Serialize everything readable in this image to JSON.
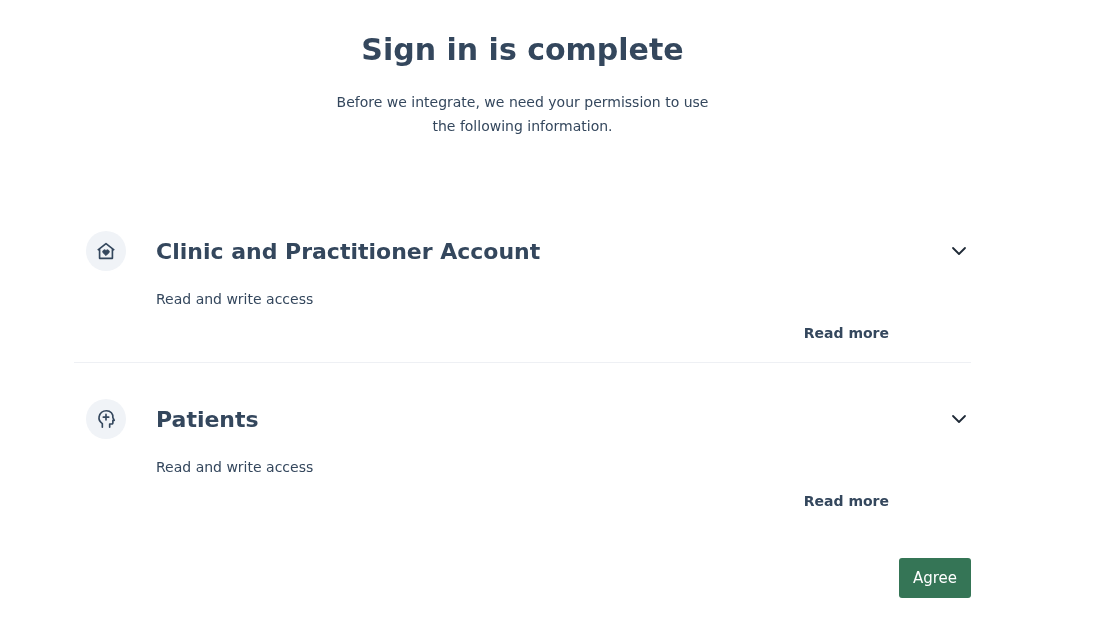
{
  "title": "Sign in is complete",
  "subtitle": "Before we integrate, we need your permission to use the following information.",
  "permissions": [
    {
      "title": "Clinic and Practitioner Account",
      "access": "Read and write access",
      "link": "Read more"
    },
    {
      "title": "Patients",
      "access": "Read and write access",
      "link": "Read more"
    }
  ],
  "button": "Agree"
}
